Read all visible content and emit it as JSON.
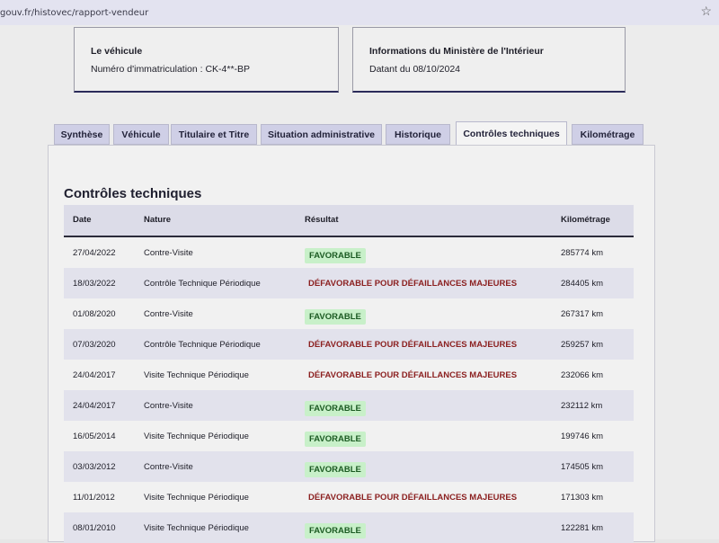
{
  "browser": {
    "url": "gouv.fr/histovec/rapport-vendeur"
  },
  "vehicle_card": {
    "title": "Le véhicule",
    "plate": "Numéro d'immatriculation : CK-4**-BP"
  },
  "ministry_card": {
    "title": "Informations du Ministère de l'Intérieur",
    "date": "Datant du 08/10/2024"
  },
  "tabs": [
    {
      "label": "Synthèse"
    },
    {
      "label": "Véhicule"
    },
    {
      "label": "Titulaire et Titre"
    },
    {
      "label": "Situation administrative"
    },
    {
      "label": "Historique"
    },
    {
      "label": "Contrôles techniques"
    },
    {
      "label": "Kilométrage"
    }
  ],
  "active_tab": "Contrôles techniques",
  "section": {
    "title": "Contrôles techniques",
    "headers": {
      "date": "Date",
      "nature": "Nature",
      "result": "Résultat",
      "km": "Kilométrage"
    },
    "rows": [
      {
        "date": "27/04/2022",
        "nature": "Contre-Visite",
        "result": "FAVORABLE",
        "status": "fav",
        "km": "285774 km"
      },
      {
        "date": "18/03/2022",
        "nature": "Contrôle Technique Périodique",
        "result": "DÉFAVORABLE POUR DÉFAILLANCES MAJEURES",
        "status": "def",
        "km": "284405 km"
      },
      {
        "date": "01/08/2020",
        "nature": "Contre-Visite",
        "result": "FAVORABLE",
        "status": "fav",
        "km": "267317 km"
      },
      {
        "date": "07/03/2020",
        "nature": "Contrôle Technique Périodique",
        "result": "DÉFAVORABLE POUR DÉFAILLANCES MAJEURES",
        "status": "def",
        "km": "259257 km"
      },
      {
        "date": "24/04/2017",
        "nature": "Visite Technique Périodique",
        "result": "DÉFAVORABLE POUR DÉFAILLANCES MAJEURES",
        "status": "def",
        "km": "232066 km"
      },
      {
        "date": "24/04/2017",
        "nature": "Contre-Visite",
        "result": "FAVORABLE",
        "status": "fav",
        "km": "232112 km"
      },
      {
        "date": "16/05/2014",
        "nature": "Visite Technique Périodique",
        "result": "FAVORABLE",
        "status": "fav",
        "km": "199746 km"
      },
      {
        "date": "03/03/2012",
        "nature": "Contre-Visite",
        "result": "FAVORABLE",
        "status": "fav",
        "km": "174505 km"
      },
      {
        "date": "11/01/2012",
        "nature": "Visite Technique Périodique",
        "result": "DÉFAVORABLE POUR DÉFAILLANCES MAJEURES",
        "status": "def",
        "km": "171303 km"
      },
      {
        "date": "08/01/2010",
        "nature": "Visite Technique Périodique",
        "result": "FAVORABLE",
        "status": "fav",
        "km": "122281 km"
      }
    ]
  },
  "colors": {
    "favorable_bg": "#c8f0c9",
    "favorable_text": "#1b5a22",
    "defavorable_text": "#8b1f1f",
    "tab_bg": "#cfcfe6"
  },
  "icons": {
    "bookmark": "star-icon"
  }
}
